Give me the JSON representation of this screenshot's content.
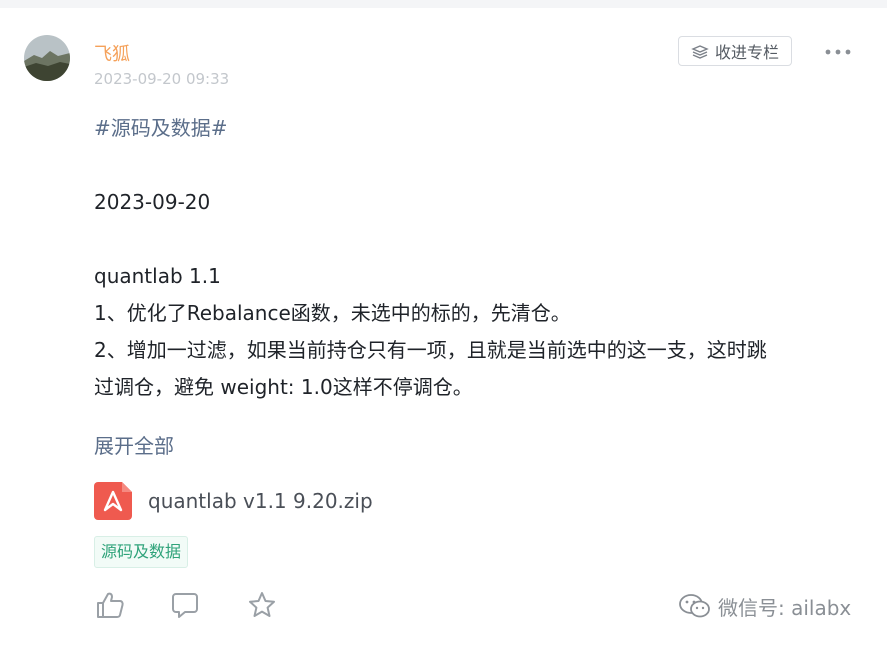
{
  "post": {
    "author": "飞狐",
    "timestamp": "2023-09-20 09:33",
    "collect_label": "收进专栏",
    "hashtag": "#源码及数据#",
    "date_line": "2023-09-20",
    "lines": [
      "quantlab 1.1",
      "1、优化了Rebalance函数，未选中的标的，先清仓。",
      "2、增加一过滤，如果当前持仓只有一项，且就是当前选中的这一支，这时跳",
      "过调仓，避免 weight: 1.0这样不停调仓。"
    ],
    "expand_label": "展开全部",
    "attachment": {
      "name": "quantlab v1.1 9.20.zip",
      "icon": "pdf-file-icon"
    },
    "tag": "源码及数据"
  },
  "actions": [
    {
      "icon": "thumbs-up-icon"
    },
    {
      "icon": "comment-icon"
    },
    {
      "icon": "star-icon"
    }
  ],
  "watermark": {
    "text": "微信号: ailabx",
    "icon": "wechat-icon"
  },
  "colors": {
    "author": "#f5a15a",
    "link": "#5b6e8a",
    "tag_text": "#2fa37a",
    "file_icon": "#ef5a4f"
  }
}
